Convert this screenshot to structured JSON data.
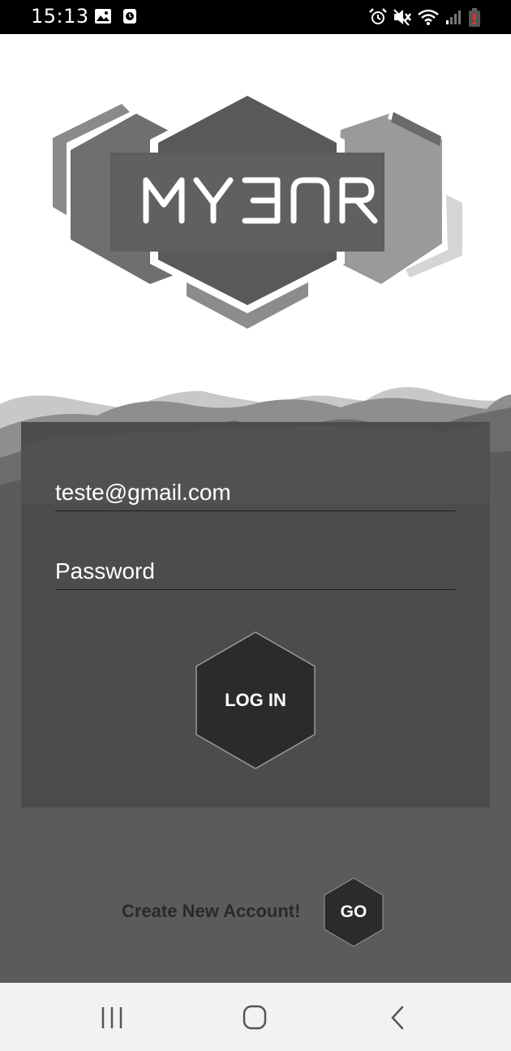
{
  "status_bar": {
    "time": "15:13",
    "left_icons": [
      "image-icon",
      "clock-notification-icon"
    ],
    "right_icons": [
      "alarm-icon",
      "mute-icon",
      "wifi-icon",
      "signal-icon",
      "battery-low-icon"
    ]
  },
  "logo": {
    "text": "MYBAR",
    "icon": "hexagon-logo"
  },
  "login": {
    "email_value": "teste@gmail.com",
    "password_placeholder": "Password",
    "login_label": "LOG IN"
  },
  "signup": {
    "prompt": "Create New Account!",
    "go_label": "GO"
  },
  "nav": {
    "icons": [
      "recents-icon",
      "home-icon",
      "back-icon"
    ]
  },
  "colors": {
    "panel": "#4c4c4c",
    "background_dark": "#5a5a5a",
    "hex_button": "#2b2b2b",
    "nav_bar": "#f2f2f2"
  }
}
